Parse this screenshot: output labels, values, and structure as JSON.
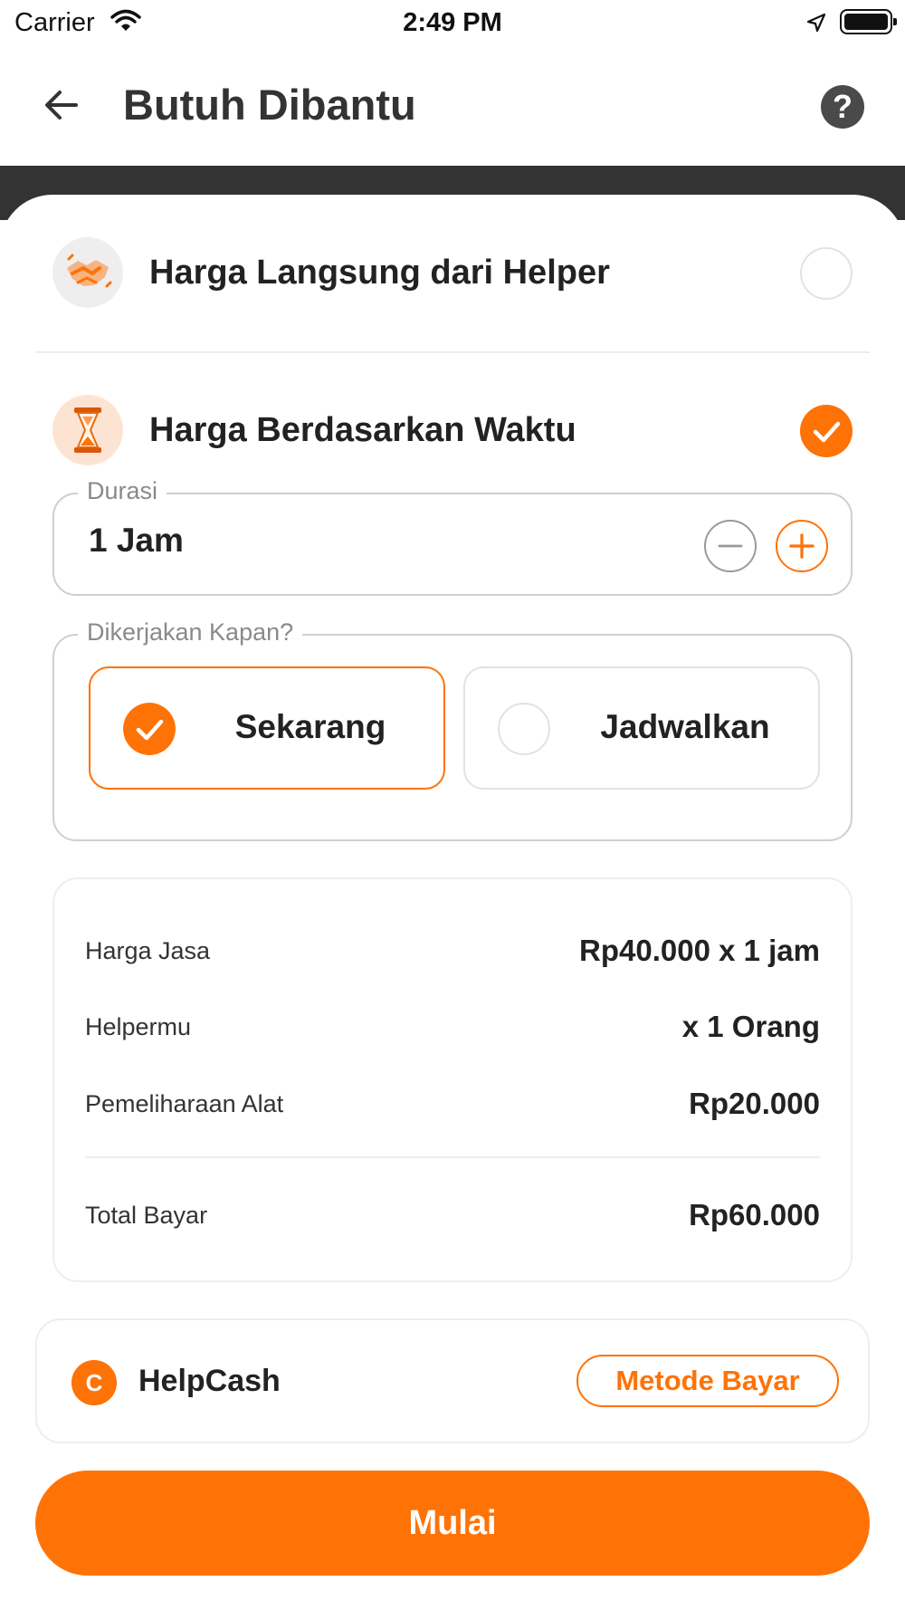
{
  "status_bar": {
    "carrier": "Carrier",
    "time": "2:49 PM",
    "icons": [
      "wifi-icon",
      "location-arrow-icon",
      "battery-icon"
    ]
  },
  "header": {
    "title": "Butuh Dibantu",
    "back_icon": "arrow-left-icon",
    "help_icon": "question-mark-icon",
    "help_glyph": "?"
  },
  "pricing_options": [
    {
      "label": "Harga Langsung dari Helper",
      "icon": "handshake-icon",
      "selected": false
    },
    {
      "label": "Harga Berdasarkan Waktu",
      "icon": "hourglass-icon",
      "selected": true
    }
  ],
  "duration": {
    "legend": "Durasi",
    "value": "1 Jam",
    "decrement_icon": "minus-circle-icon",
    "increment_icon": "plus-circle-icon"
  },
  "schedule": {
    "legend": "Dikerjakan Kapan?",
    "options": [
      {
        "label": "Sekarang",
        "selected": true
      },
      {
        "label": "Jadwalkan",
        "selected": false
      }
    ]
  },
  "summary": {
    "rows": [
      {
        "label": "Harga Jasa",
        "value": "Rp40.000 x 1 jam"
      },
      {
        "label": "Helpermu",
        "value": "x 1 Orang"
      },
      {
        "label": "Pemeliharaan Alat",
        "value": "Rp20.000"
      }
    ],
    "total": {
      "label": "Total Bayar",
      "value": "Rp60.000"
    }
  },
  "payment": {
    "method": "HelpCash",
    "icon": "helpcash-coin-icon",
    "icon_glyph": "C",
    "change_label": "Metode Bayar"
  },
  "cta": {
    "label": "Mulai"
  },
  "colors": {
    "accent": "#ff7206",
    "header_band": "#333333",
    "text": "#222222",
    "muted": "#8a8a8a"
  }
}
